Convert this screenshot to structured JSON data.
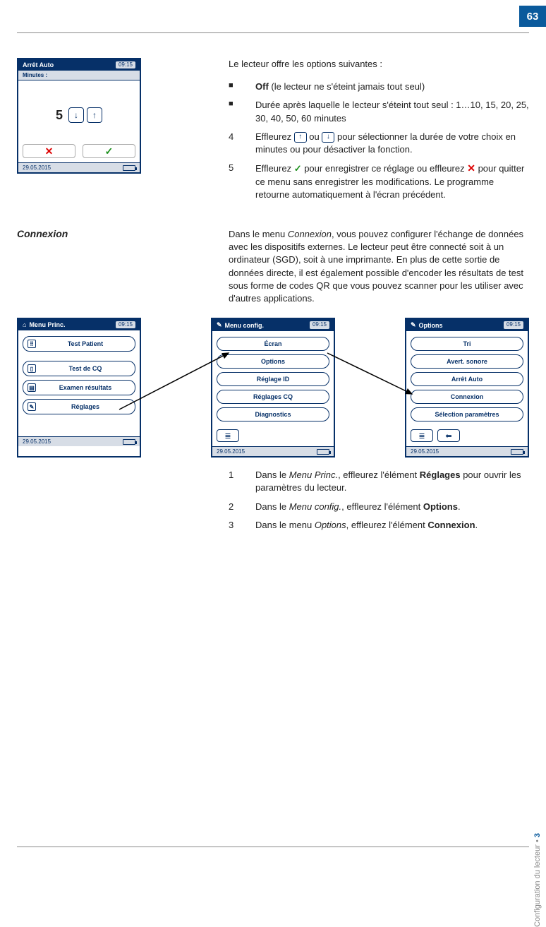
{
  "page_number": "63",
  "side_label": {
    "text": "Configuration du lecteur",
    "chapter": "3",
    "sep": "•"
  },
  "intro": "Le lecteur offre les options suivantes :",
  "bullets": [
    {
      "bold": "Off",
      "rest": " (le lecteur ne s'éteint jamais tout seul)"
    },
    {
      "bold": "",
      "rest": "Durée après laquelle le lecteur s'éteint tout seul : 1…10, 15, 20, 25, 30, 40, 50, 60 minutes"
    }
  ],
  "steps_a": [
    {
      "n": "4",
      "pre": "Effleurez ",
      "mid": " ou ",
      "post": " pour sélectionner la durée de votre choix en minutes ou pour désactiver la fonction."
    },
    {
      "n": "5",
      "pre": "Effleurez ",
      "mid": " pour enregistrer ce réglage ou effleurez ",
      "post": " pour quitter ce menu sans enregistrer les modifications. Le programme retourne automatiquement à l'écran précédent."
    }
  ],
  "section_heading": "Connexion",
  "section_body": "Dans le menu Connexion, vous pouvez configurer l'échange de données avec les dispositifs externes. Le lecteur peut être connecté soit à un ordinateur (SGD), soit à une imprimante. En plus de cette sortie de données directe, il est également possible d'encoder les résultats de test sous forme de codes QR que vous pouvez scanner pour les utiliser avec d'autres applications.",
  "steps_b": [
    {
      "n": "1",
      "pre": "Dans le ",
      "it": "Menu Princ.",
      "mid": ", effleurez l'élément ",
      "bold": "Réglages",
      "post": " pour ouvrir les paramètres du lecteur."
    },
    {
      "n": "2",
      "pre": "Dans le ",
      "it": "Menu config.",
      "mid": ", effleurez l'élément ",
      "bold": "Options",
      "post": "."
    },
    {
      "n": "3",
      "pre": "Dans le menu ",
      "it": "Options",
      "mid": ", effleurez l'élément ",
      "bold": "Connexion",
      "post": "."
    }
  ],
  "screen1": {
    "title": "Arrêt Auto",
    "time": "09:15",
    "sub": "Minutes :",
    "value": "5",
    "date": "29.05.2015"
  },
  "screen2": {
    "title": "Menu Princ.",
    "time": "09:15",
    "date": "29.05.2015",
    "items": [
      "Test Patient",
      "Test de CQ",
      "Examen résultats",
      "Réglages"
    ]
  },
  "screen3": {
    "title": "Menu config.",
    "time": "09:15",
    "date": "29.05.2015",
    "items": [
      "Écran",
      "Options",
      "Réglage ID",
      "Réglages CQ",
      "Diagnostics"
    ]
  },
  "screen4": {
    "title": "Options",
    "time": "09:15",
    "date": "29.05.2015",
    "items": [
      "Tri",
      "Avert. sonore",
      "Arrêt Auto",
      "Connexion",
      "Sélection paramètres"
    ]
  },
  "icons": {
    "up": "↑",
    "down": "↓",
    "check": "✓",
    "x": "✕",
    "back": "⬅",
    "list": "≣",
    "drop": "⠿",
    "tube": "▯",
    "sheet": "▤",
    "wrench": "✎"
  }
}
